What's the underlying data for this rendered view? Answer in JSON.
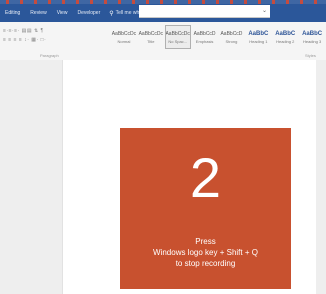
{
  "menu": {
    "items": [
      "Editing",
      "Review",
      "View",
      "Developer"
    ],
    "tell_me": "Tell me what you want to do"
  },
  "ribbon": {
    "paragraph_label": "Paragraph",
    "styles_label": "Styles",
    "styles": [
      {
        "preview": "AaBbCcDc",
        "name": "Normal"
      },
      {
        "preview": "AaBbCcDc",
        "name": "Title"
      },
      {
        "preview": "AaBbCcDc",
        "name": "No Spac..."
      },
      {
        "preview": "AaBbCcD",
        "name": "Emphasis"
      },
      {
        "preview": "AaBbCcD",
        "name": "Strong"
      },
      {
        "preview": "AaBbC",
        "name": "Heading 1"
      },
      {
        "preview": "AaBbC",
        "name": "Heading 2"
      },
      {
        "preview": "AaBbC",
        "name": "Heading 3"
      }
    ]
  },
  "overlay": {
    "countdown": "2",
    "line1": "Press",
    "line2": "Windows logo key + Shift + Q",
    "line3": "to stop recording",
    "color": "#c8512f"
  },
  "colors": {
    "ribbon_bar": "#2b579a"
  }
}
